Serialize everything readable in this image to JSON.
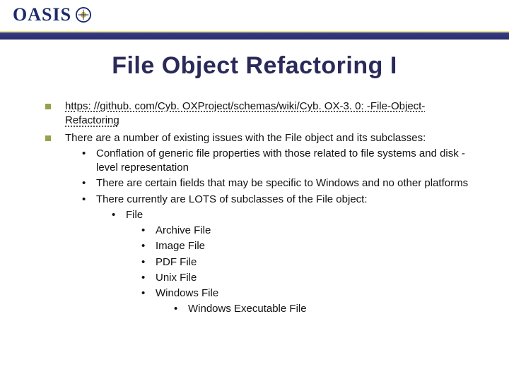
{
  "logo": {
    "text": "OASIS"
  },
  "title": "File Object Refactoring I",
  "bullets": {
    "link": "https: //github. com/Cyb. OXProject/schemas/wiki/Cyb. OX-3. 0: -File-Object-Refactoring",
    "intro": "There are a number of existing issues with the File object and its subclasses:",
    "issue1": "Conflation of generic file properties with those related to file systems and disk -level representation",
    "issue2": "There are certain fields that may be specific to Windows and no other platforms",
    "issue3": "There currently are LOTS of subclasses of the File object:",
    "root_class": "File",
    "subclasses": [
      "Archive File",
      "Image File",
      "PDF File",
      "Unix File",
      "Windows File"
    ],
    "windows_sub": "Windows Executable File"
  }
}
